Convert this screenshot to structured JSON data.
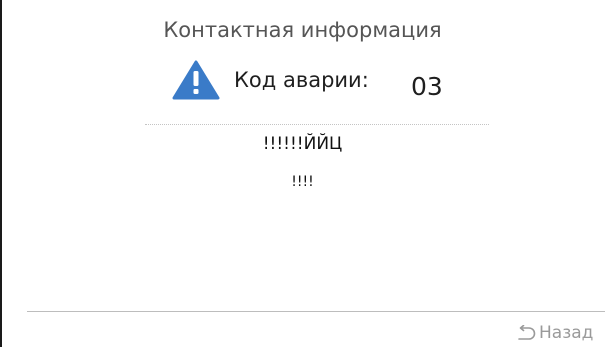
{
  "header": {
    "title": "Контактная информация"
  },
  "alarm": {
    "icon": "warning-icon",
    "icon_color": "#3a7bc8",
    "label": "Код аварии:",
    "code": "03"
  },
  "contact": {
    "line1": "!!!!!!ЙЙЦ",
    "line2": "!!!!"
  },
  "footer": {
    "back_icon": "back-arrow-icon",
    "back_label": "Назад"
  }
}
